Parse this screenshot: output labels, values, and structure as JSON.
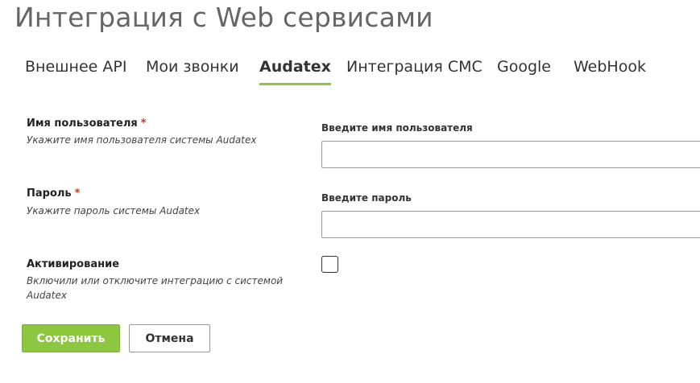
{
  "page": {
    "title": "Интеграция с Web сервисами"
  },
  "tabs": [
    {
      "label": "Внешнее API",
      "active": false
    },
    {
      "label": "Мои звонки",
      "active": false
    },
    {
      "label": "Audatex",
      "active": true
    },
    {
      "label": "Интеграция СМС",
      "active": false
    },
    {
      "label": "Google",
      "active": false
    },
    {
      "label": "WebHook",
      "active": false
    }
  ],
  "form": {
    "username": {
      "label": "Имя пользователя",
      "required_mark": "*",
      "hint": "Укажите имя пользователя системы Audatex",
      "caption": "Введите имя пользователя",
      "value": ""
    },
    "password": {
      "label": "Пароль",
      "required_mark": "*",
      "hint": "Укажите пароль системы Audatex",
      "caption": "Введите пароль",
      "value": ""
    },
    "activation": {
      "label": "Активирование",
      "hint": "Включили или отключите интеграцию с системой Audatex",
      "checked": false
    }
  },
  "actions": {
    "save_label": "Сохранить",
    "cancel_label": "Отмена"
  },
  "colors": {
    "accent": "#8dc63f",
    "required": "#c0392b"
  }
}
